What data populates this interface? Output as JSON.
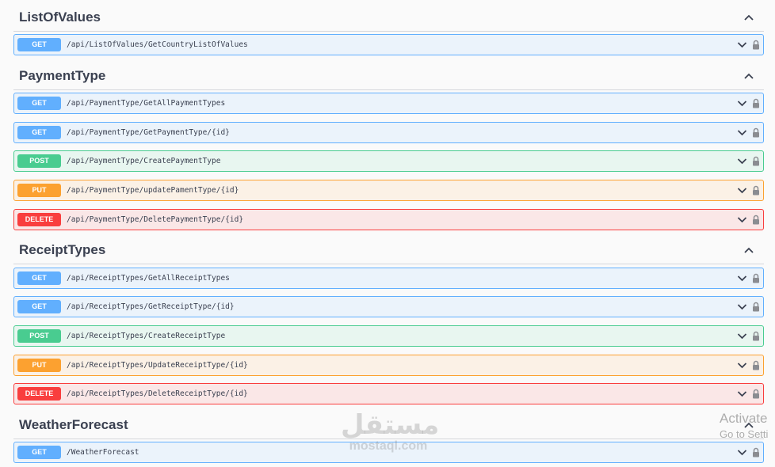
{
  "colors": {
    "get": "#61affe",
    "post": "#49cc90",
    "put": "#fca130",
    "delete": "#f93e3e"
  },
  "icons": {
    "collapse": "chevron-up-icon",
    "expand": "chevron-down-icon",
    "auth": "lock-icon"
  },
  "sections": [
    {
      "title": "ListOfValues",
      "operations": [
        {
          "method": "GET",
          "path": "/api/ListOfValues/GetCountryListOfValues"
        }
      ]
    },
    {
      "title": "PaymentType",
      "operations": [
        {
          "method": "GET",
          "path": "/api/PaymentType/GetAllPaymentTypes"
        },
        {
          "method": "GET",
          "path": "/api/PaymentType/GetPaymentType/{id}"
        },
        {
          "method": "POST",
          "path": "/api/PaymentType/CreatePaymentType"
        },
        {
          "method": "PUT",
          "path": "/api/PaymentType/updatePamentType/{id}"
        },
        {
          "method": "DELETE",
          "path": "/api/PaymentType/DeletePaymentType/{id}"
        }
      ]
    },
    {
      "title": "ReceiptTypes",
      "operations": [
        {
          "method": "GET",
          "path": "/api/ReceiptTypes/GetAllReceiptTypes"
        },
        {
          "method": "GET",
          "path": "/api/ReceiptTypes/GetReceiptType/{id}"
        },
        {
          "method": "POST",
          "path": "/api/ReceiptTypes/CreateReceiptType"
        },
        {
          "method": "PUT",
          "path": "/api/ReceiptTypes/UpdateReceiptType/{id}"
        },
        {
          "method": "DELETE",
          "path": "/api/ReceiptTypes/DeleteReceiptType/{id}"
        }
      ]
    },
    {
      "title": "WeatherForecast",
      "operations": [
        {
          "method": "GET",
          "path": "/WeatherForecast"
        }
      ]
    }
  ],
  "watermark": {
    "arabic": "مستقل",
    "latin": "mostaql.com"
  },
  "activation": {
    "title": "Activate",
    "subtitle": "Go to Setti"
  }
}
